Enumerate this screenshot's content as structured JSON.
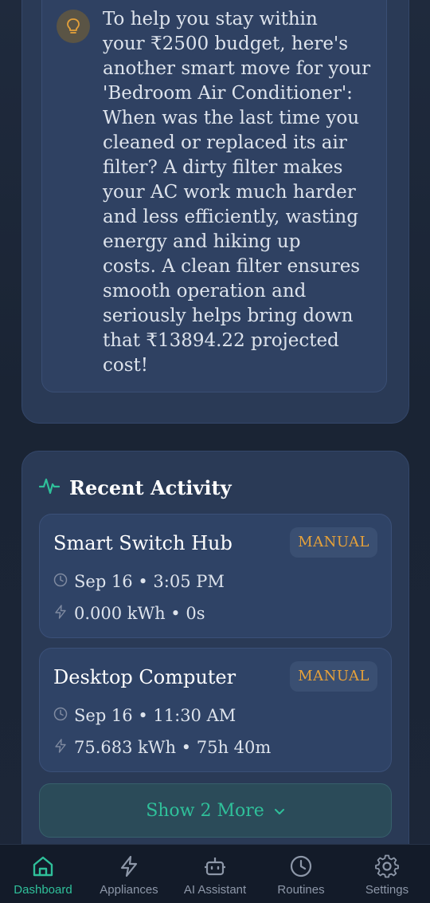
{
  "tip": {
    "icon": "lightbulb-icon",
    "text": "To help you stay within\nyour ₹2500 budget, here's\nanother smart move for your\n'Bedroom Air Conditioner':\nWhen was the last time you\ncleaned or replaced its air\nfilter? A dirty filter makes\nyour AC work much harder\nand less efficiently, wasting\nenergy and hiking up\ncosts. A clean filter ensures\nsmooth operation and\nseriously helps bring down\nthat ₹13894.22 projected\ncost!"
  },
  "recent_activity": {
    "title": "Recent Activity",
    "icon": "activity-pulse-icon",
    "items": [
      {
        "name": "Smart Switch Hub",
        "mode": "MANUAL",
        "time": "Sep 16 • 3:05 PM",
        "energy": "0.000 kWh • 0s"
      },
      {
        "name": "Desktop Computer",
        "mode": "MANUAL",
        "time": "Sep 16 • 11:30 AM",
        "energy": "75.683 kWh • 75h 40m"
      }
    ],
    "show_more_label": "Show 2 More"
  },
  "nav": {
    "items": [
      {
        "label": "Dashboard",
        "icon": "home-icon",
        "active": true
      },
      {
        "label": "Appliances",
        "icon": "lightning-icon",
        "active": false
      },
      {
        "label": "AI Assistant",
        "icon": "robot-icon",
        "active": false
      },
      {
        "label": "Routines",
        "icon": "clock-icon",
        "active": false
      },
      {
        "label": "Settings",
        "icon": "gear-icon",
        "active": false
      }
    ]
  },
  "colors": {
    "accent": "#2fc09a",
    "badge_text": "#e5a13a",
    "card_bg": "#2a3a56",
    "nav_bg": "#131b29"
  }
}
